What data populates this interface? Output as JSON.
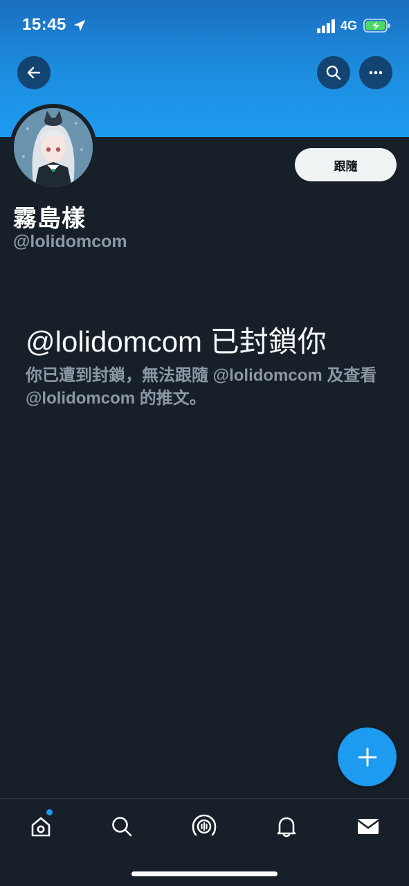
{
  "status_bar": {
    "time": "15:45",
    "network": "4G"
  },
  "header": {
    "back_icon": "arrow-left-icon",
    "search_icon": "search-icon",
    "more_icon": "more-horizontal-icon"
  },
  "profile": {
    "display_name": "霧島樣",
    "handle": "@lolidomcom",
    "follow_label": "跟隨"
  },
  "blocked": {
    "title": "@lolidomcom 已封鎖你",
    "description": "你已遭到封鎖，無法跟隨 @lolidomcom 及查看 @lolidomcom 的推文。"
  },
  "bottom_nav": {
    "items": [
      "home-icon",
      "search-icon",
      "spaces-icon",
      "notifications-icon",
      "messages-icon"
    ]
  },
  "colors": {
    "accent": "#1d9bf0",
    "background": "#172029",
    "secondary_text": "#8b98a5"
  }
}
